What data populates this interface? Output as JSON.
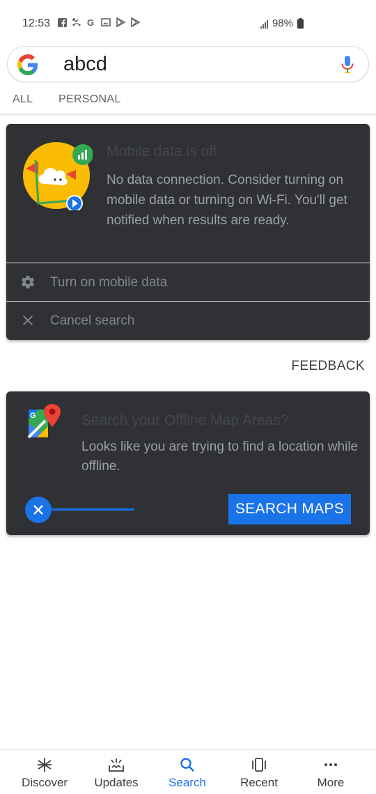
{
  "status_bar": {
    "time": "12:53",
    "battery": "98%",
    "notification_icons": [
      "facebook-icon",
      "missed-call-icon",
      "google-icon",
      "gallery-icon",
      "play-store-icon",
      "play-store-icon"
    ]
  },
  "search": {
    "query": "abcd",
    "mic_icon": "mic-icon"
  },
  "tabs": [
    {
      "label": "ALL"
    },
    {
      "label": "PERSONAL"
    }
  ],
  "offline_card": {
    "title": "Mobile data is off",
    "message": "No data connection. Consider turning on mobile data or turning on Wi-Fi. You'll get notified when results are ready.",
    "actions": [
      {
        "label": "Turn on mobile data",
        "icon": "gear-icon"
      },
      {
        "label": "Cancel search",
        "icon": "close-icon"
      }
    ]
  },
  "feedback_label": "FEEDBACK",
  "maps_card": {
    "title": "Search your Offline Map Areas?",
    "message": "Looks like you are trying to find a location while offline.",
    "button_label": "SEARCH MAPS"
  },
  "bottom_nav": [
    {
      "label": "Discover",
      "icon": "asterisk-icon"
    },
    {
      "label": "Updates",
      "icon": "updates-icon"
    },
    {
      "label": "Search",
      "icon": "search-icon",
      "active": true
    },
    {
      "label": "Recent",
      "icon": "recent-icon"
    },
    {
      "label": "More",
      "icon": "more-icon"
    }
  ],
  "colors": {
    "accent": "#1a73e8",
    "card_bg": "#303134"
  }
}
